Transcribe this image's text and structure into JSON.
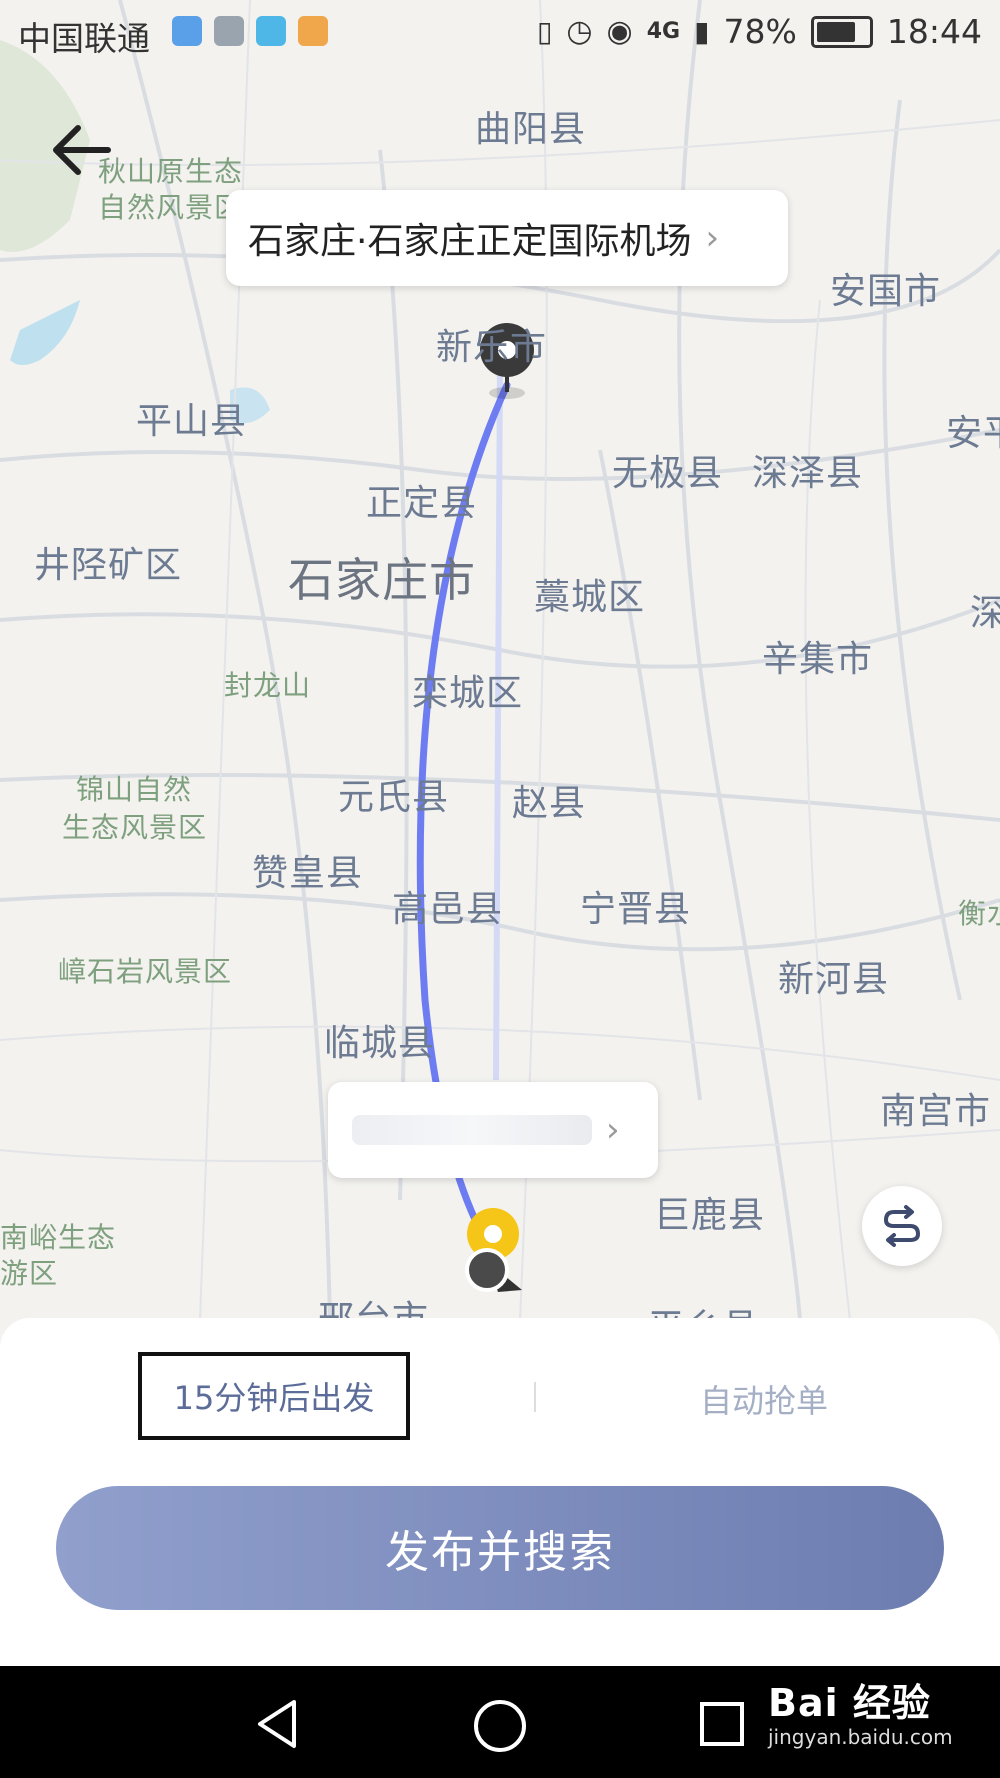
{
  "status_bar": {
    "carrier": "中国联通",
    "network": "4G",
    "battery": "78%",
    "time": "18:44"
  },
  "map": {
    "labels": [
      {
        "text": "曲阳县",
        "style": "normal"
      },
      {
        "text": "秋山原生态",
        "style": "green"
      },
      {
        "text": "自然风景区",
        "style": "green"
      },
      {
        "text": "安国市",
        "style": "normal"
      },
      {
        "text": "新乐市",
        "style": "normal"
      },
      {
        "text": "平山县",
        "style": "normal"
      },
      {
        "text": "无极县",
        "style": "normal"
      },
      {
        "text": "深泽县",
        "style": "normal"
      },
      {
        "text": "安平",
        "style": "normal"
      },
      {
        "text": "正定县",
        "style": "normal"
      },
      {
        "text": "井陉矿区",
        "style": "normal"
      },
      {
        "text": "石家庄市",
        "style": "big"
      },
      {
        "text": "藁城区",
        "style": "normal"
      },
      {
        "text": "深",
        "style": "normal"
      },
      {
        "text": "辛集市",
        "style": "normal"
      },
      {
        "text": "封龙山",
        "style": "green"
      },
      {
        "text": "栾城区",
        "style": "normal"
      },
      {
        "text": "锦山自然",
        "style": "green"
      },
      {
        "text": "生态风景区",
        "style": "green"
      },
      {
        "text": "元氏县",
        "style": "normal"
      },
      {
        "text": "赵县",
        "style": "normal"
      },
      {
        "text": "赞皇县",
        "style": "normal"
      },
      {
        "text": "高邑县",
        "style": "normal"
      },
      {
        "text": "宁晋县",
        "style": "normal"
      },
      {
        "text": "衡水",
        "style": "normal"
      },
      {
        "text": "嶂石岩风景区",
        "style": "green"
      },
      {
        "text": "新河县",
        "style": "normal"
      },
      {
        "text": "临城县",
        "style": "normal"
      },
      {
        "text": "南宫市",
        "style": "normal"
      },
      {
        "text": "巨鹿县",
        "style": "normal"
      },
      {
        "text": "南峪生态",
        "style": "green"
      },
      {
        "text": "游区",
        "style": "green"
      },
      {
        "text": "邢台市",
        "style": "normal"
      },
      {
        "text": "平乡县",
        "style": "normal"
      }
    ]
  },
  "destination_callout": {
    "text": "石家庄·石家庄正定国际机场",
    "chevron": "›"
  },
  "origin_callout": {
    "chevron": "›"
  },
  "icons": {
    "back": "back-arrow-icon",
    "swap": "swap-route-icon"
  },
  "bottom_sheet": {
    "depart_label": "15分钟后出发",
    "auto_label": "自动抢单",
    "publish_label": "发布并搜索"
  },
  "watermark": {
    "main": "Bai  经验",
    "sub": "jingyan.baidu.com"
  },
  "colors": {
    "route": "#6e7cf2",
    "accent": "#6d7db0",
    "marker_yellow": "#f5c518"
  }
}
